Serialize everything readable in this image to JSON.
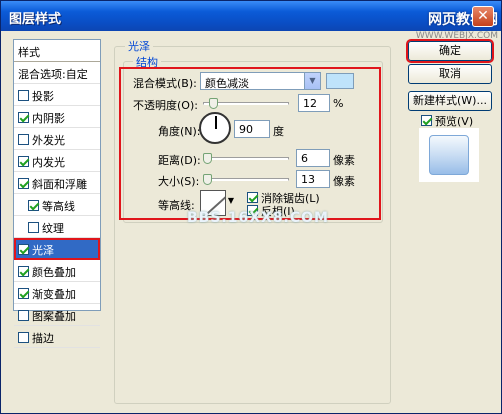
{
  "window": {
    "title": "图层样式",
    "close": "✕"
  },
  "watermark": {
    "text": "网页教学网",
    "url": "WWW.WEBJX.COM",
    "center": "BBS.16XX8.COM"
  },
  "styles": {
    "header": "样式",
    "blend_options": "混合选项:自定",
    "items": [
      {
        "label": "投影",
        "checked": false
      },
      {
        "label": "内阴影",
        "checked": true
      },
      {
        "label": "外发光",
        "checked": false
      },
      {
        "label": "内发光",
        "checked": true
      },
      {
        "label": "斜面和浮雕",
        "checked": true
      },
      {
        "label": "等高线",
        "checked": true
      },
      {
        "label": "纹理",
        "checked": false
      },
      {
        "label": "光泽",
        "checked": true,
        "selected": true
      },
      {
        "label": "颜色叠加",
        "checked": true
      },
      {
        "label": "渐变叠加",
        "checked": true
      },
      {
        "label": "图案叠加",
        "checked": false
      },
      {
        "label": "描边",
        "checked": false
      }
    ]
  },
  "panel": {
    "group_title": "光泽",
    "structure_title": "结构",
    "blend_mode_label": "混合模式(B):",
    "blend_mode_value": "颜色减淡",
    "swatch_color": "#bfe3fb",
    "opacity_label": "不透明度(O):",
    "opacity_value": "12",
    "opacity_unit": "%",
    "opacity_level": 0.12,
    "angle_label": "角度(N):",
    "angle_value": "90",
    "angle_unit": "度",
    "distance_label": "距离(D):",
    "distance_value": "6",
    "distance_unit": "像素",
    "size_label": "大小(S):",
    "size_value": "13",
    "size_unit": "像素",
    "contour_label": "等高线:",
    "antialias_label": "消除锯齿(L)",
    "antialias_checked": true,
    "invert_label": "反相(I)",
    "invert_checked": true
  },
  "buttons": {
    "ok": "确定",
    "cancel": "取消",
    "new_style": "新建样式(W)...",
    "preview_label": "预览(V)",
    "preview_checked": true
  },
  "colors": {
    "accent_red": "#e0151b",
    "selection_blue": "#316ac5",
    "title_blue": "#0b5bd8"
  }
}
